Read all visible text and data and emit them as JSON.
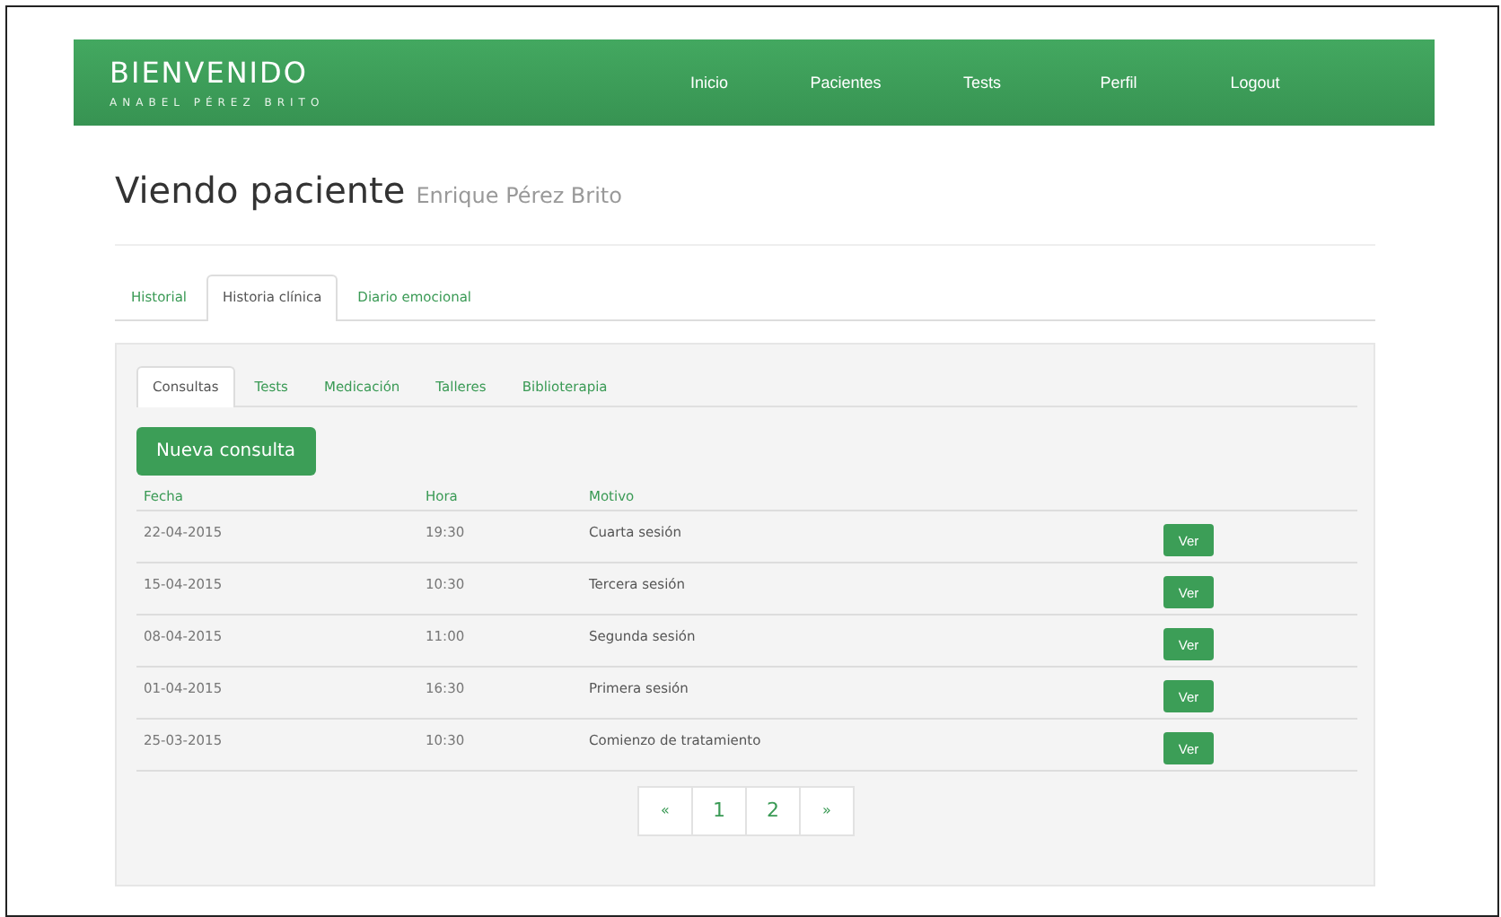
{
  "header": {
    "title": "BIENVENIDO",
    "subtitle": "ANABEL PÉREZ BRITO",
    "nav": [
      "Inicio",
      "Pacientes",
      "Tests",
      "Perfil",
      "Logout"
    ]
  },
  "page": {
    "title": "Viendo paciente",
    "patient": "Enrique Pérez Brito"
  },
  "tabs": [
    {
      "label": "Historial",
      "selected": false
    },
    {
      "label": "Historia clínica",
      "selected": true
    },
    {
      "label": "Diario emocional",
      "selected": false
    }
  ],
  "subtabs": [
    {
      "label": "Consultas",
      "selected": true
    },
    {
      "label": "Tests",
      "selected": false
    },
    {
      "label": "Medicación",
      "selected": false
    },
    {
      "label": "Talleres",
      "selected": false
    },
    {
      "label": "Biblioterapia",
      "selected": false
    }
  ],
  "new_button": "Nueva consulta",
  "table": {
    "columns": [
      "Fecha",
      "Hora",
      "Motivo"
    ],
    "rows": [
      {
        "fecha": "22-04-2015",
        "hora": "19:30",
        "motivo": "Cuarta sesión",
        "action": "Ver"
      },
      {
        "fecha": "15-04-2015",
        "hora": "10:30",
        "motivo": "Tercera sesión",
        "action": "Ver"
      },
      {
        "fecha": "08-04-2015",
        "hora": "11:00",
        "motivo": "Segunda sesión",
        "action": "Ver"
      },
      {
        "fecha": "01-04-2015",
        "hora": "16:30",
        "motivo": "Primera sesión",
        "action": "Ver"
      },
      {
        "fecha": "25-03-2015",
        "hora": "10:30",
        "motivo": "Comienzo de tratamiento",
        "action": "Ver"
      }
    ]
  },
  "pagination": [
    "«",
    "1",
    "2",
    "»"
  ]
}
